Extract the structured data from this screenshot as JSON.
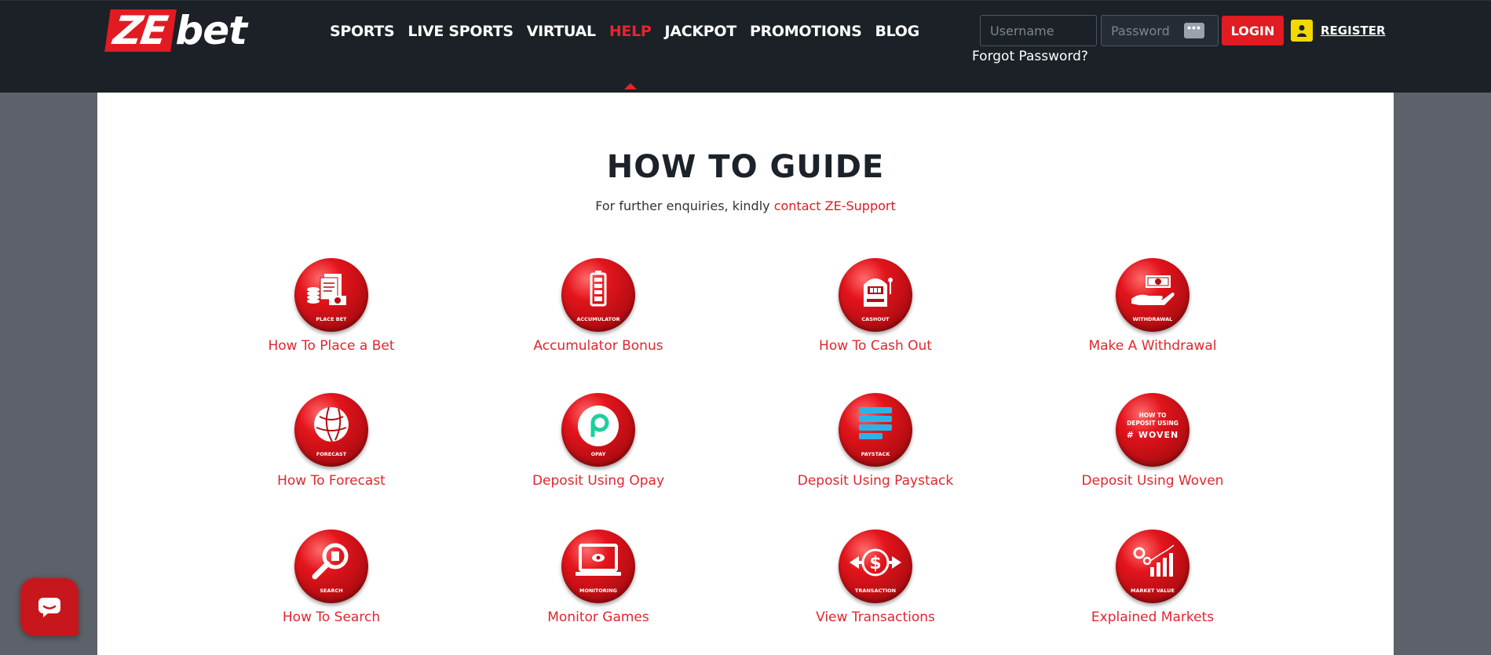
{
  "logo": {
    "part1": "ZE",
    "part2": "bet"
  },
  "nav": [
    {
      "label": "SPORTS",
      "active": false
    },
    {
      "label": "LIVE SPORTS",
      "active": false
    },
    {
      "label": "VIRTUAL",
      "active": false
    },
    {
      "label": "HELP",
      "active": true
    },
    {
      "label": "JACKPOT",
      "active": false
    },
    {
      "label": "PROMOTIONS",
      "active": false
    },
    {
      "label": "BLOG",
      "active": false
    }
  ],
  "login": {
    "username_placeholder": "Username",
    "password_placeholder": "Password",
    "password_toggle": "•••",
    "login_label": "LOGIN",
    "register_label": "REGISTER",
    "forgot_label": "Forgot Password?"
  },
  "page": {
    "title": "HOW TO GUIDE",
    "subtitle_prefix": "For further enquiries, kindly ",
    "subtitle_link": "contact ZE-Support"
  },
  "guides": [
    {
      "label": "How To Place a Bet",
      "icon": "place-bet-icon",
      "caption": "PLACE BET"
    },
    {
      "label": "Accumulator Bonus",
      "icon": "accumulator-icon",
      "caption": "ACCUMULATOR"
    },
    {
      "label": "How To Cash Out",
      "icon": "cashout-icon",
      "caption": "CASHOUT"
    },
    {
      "label": "Make A Withdrawal",
      "icon": "withdrawal-icon",
      "caption": "WITHDRAWAL"
    },
    {
      "label": "How To Forecast",
      "icon": "forecast-icon",
      "caption": "FORECAST"
    },
    {
      "label": "Deposit Using Opay",
      "icon": "opay-icon",
      "caption": "OPAY"
    },
    {
      "label": "Deposit Using Paystack",
      "icon": "paystack-icon",
      "caption": "PAYSTACK"
    },
    {
      "label": "Deposit Using Woven",
      "icon": "woven-icon",
      "caption": "",
      "badge_line1": "HOW TO",
      "badge_line2": "DEPOSIT USING",
      "badge_brand": "WOVEN"
    },
    {
      "label": "How To Search",
      "icon": "search-icon",
      "caption": "SEARCH"
    },
    {
      "label": "Monitor Games",
      "icon": "monitoring-icon",
      "caption": "MONITORING"
    },
    {
      "label": "View Transactions",
      "icon": "transaction-icon",
      "caption": "TRANSACTION"
    },
    {
      "label": "Explained Markets",
      "icon": "market-value-icon",
      "caption": "MARKET VALUE"
    }
  ],
  "colors": {
    "brand_red": "#e11b22",
    "header_bg": "#1b2127",
    "register_icon": "#f5d800"
  }
}
